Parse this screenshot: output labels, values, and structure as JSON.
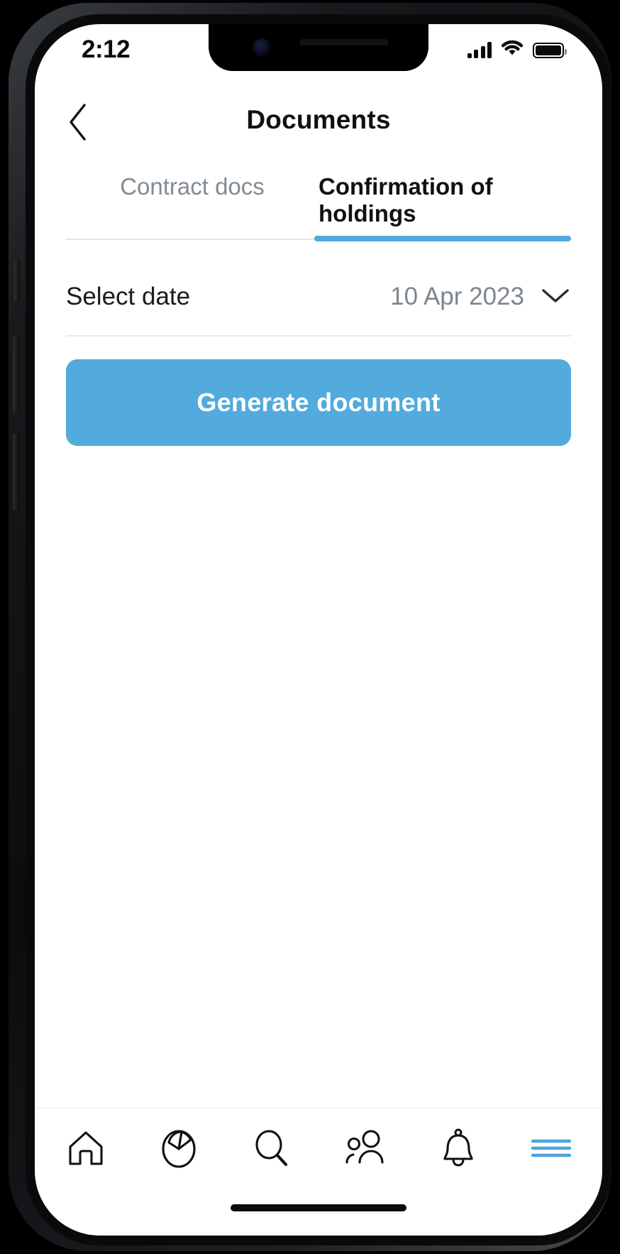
{
  "status_bar": {
    "time": "2:12",
    "signal_icon": "cellular-signal-icon",
    "wifi_icon": "wifi-icon",
    "battery_icon": "battery-full-icon"
  },
  "header": {
    "back_icon": "chevron-left-icon",
    "title": "Documents"
  },
  "tabs": {
    "items": [
      {
        "label": "Contract docs",
        "active": false
      },
      {
        "label": "Confirmation of holdings",
        "active": true
      }
    ],
    "active_index": 1,
    "indicator_color": "#53abdd"
  },
  "form": {
    "select_date": {
      "label": "Select date",
      "value": "10 Apr 2023",
      "chevron_icon": "chevron-down-icon"
    }
  },
  "actions": {
    "generate_document_label": "Generate document",
    "generate_document_color": "#53abdd"
  },
  "bottom_nav": {
    "items": [
      {
        "icon": "home-icon",
        "name": "nav-home"
      },
      {
        "icon": "pie-chart-icon",
        "name": "nav-portfolio"
      },
      {
        "icon": "search-icon",
        "name": "nav-search"
      },
      {
        "icon": "people-icon",
        "name": "nav-contacts"
      },
      {
        "icon": "bell-icon",
        "name": "nav-notifications"
      },
      {
        "icon": "hamburger-menu-icon",
        "name": "nav-menu"
      }
    ],
    "menu_color": "#4ba3dd"
  },
  "colors": {
    "accent": "#53abdd",
    "text_primary": "#111111",
    "text_muted": "#7d858d",
    "divider": "#e6e9eb",
    "background": "#ffffff"
  }
}
